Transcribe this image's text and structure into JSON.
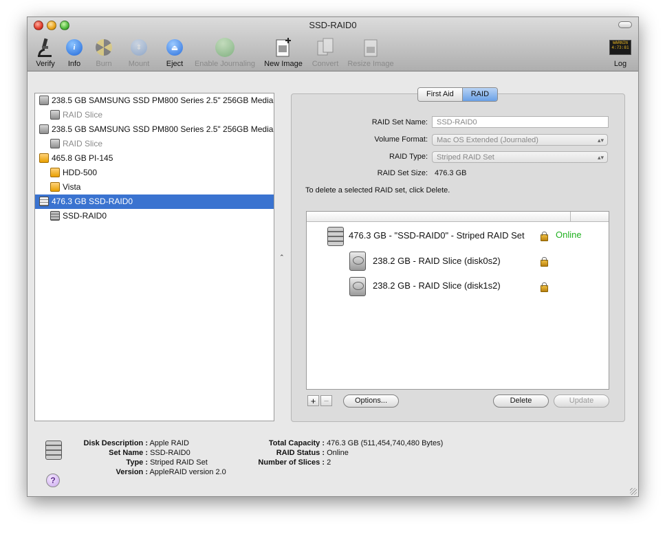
{
  "window": {
    "title": "SSD-RAID0"
  },
  "toolbar": {
    "items": [
      {
        "label": "Verify",
        "icon": "microscope-icon",
        "enabled": true
      },
      {
        "label": "Info",
        "icon": "info-icon",
        "enabled": true
      },
      {
        "label": "Burn",
        "icon": "burn-icon",
        "enabled": false
      },
      {
        "label": "Mount",
        "icon": "mount-icon",
        "enabled": false
      },
      {
        "label": "Eject",
        "icon": "eject-icon",
        "enabled": true
      },
      {
        "label": "Enable Journaling",
        "icon": "journal-icon",
        "enabled": false
      },
      {
        "label": "New Image",
        "icon": "new-image-icon",
        "enabled": true
      },
      {
        "label": "Convert",
        "icon": "convert-icon",
        "enabled": false
      },
      {
        "label": "Resize Image",
        "icon": "resize-image-icon",
        "enabled": false
      }
    ],
    "log": {
      "label": "Log",
      "icon": "log-icon"
    }
  },
  "sidebar": {
    "items": [
      {
        "label": "238.5 GB SAMSUNG SSD PM800 Series 2.5\" 256GB Media",
        "icon": "hdd-icon",
        "indent": 0,
        "dim": false,
        "selected": false
      },
      {
        "label": "RAID Slice",
        "icon": "hdd-icon",
        "indent": 1,
        "dim": true,
        "selected": false
      },
      {
        "label": "238.5 GB SAMSUNG SSD PM800 Series 2.5\" 256GB Media",
        "icon": "hdd-icon",
        "indent": 0,
        "dim": false,
        "selected": false
      },
      {
        "label": "RAID Slice",
        "icon": "hdd-icon",
        "indent": 1,
        "dim": true,
        "selected": false
      },
      {
        "label": "465.8 GB PI-145",
        "icon": "external-disk-icon",
        "indent": 0,
        "dim": false,
        "selected": false
      },
      {
        "label": "HDD-500",
        "icon": "external-disk-icon",
        "indent": 1,
        "dim": false,
        "selected": false
      },
      {
        "label": "Vista",
        "icon": "external-disk-icon",
        "indent": 1,
        "dim": false,
        "selected": false
      },
      {
        "label": "476.3 GB SSD-RAID0",
        "icon": "raid-icon",
        "indent": 0,
        "dim": false,
        "selected": true
      },
      {
        "label": "SSD-RAID0",
        "icon": "raid-icon",
        "indent": 1,
        "dim": false,
        "selected": false
      }
    ]
  },
  "tabs": [
    {
      "label": "First Aid",
      "active": false
    },
    {
      "label": "RAID",
      "active": true
    }
  ],
  "raid": {
    "set_name_label": "RAID Set Name:",
    "set_name_value": "SSD-RAID0",
    "volume_format_label": "Volume Format:",
    "volume_format_value": "Mac OS Extended (Journaled)",
    "raid_type_label": "RAID Type:",
    "raid_type_value": "Striped RAID Set",
    "set_size_label": "RAID Set Size:",
    "set_size_value": "476.3 GB",
    "hint": "To delete a selected RAID set, click Delete.",
    "rows": [
      {
        "label": "476.3 GB - \"SSD-RAID0\" - Striped RAID Set",
        "status": "Online"
      },
      {
        "label": "238.2 GB - RAID Slice (disk0s2)",
        "status": ""
      },
      {
        "label": "238.2 GB - RAID Slice (disk1s2)",
        "status": ""
      }
    ],
    "buttons": {
      "add": "+",
      "remove": "−",
      "options": "Options...",
      "delete": "Delete",
      "update": "Update"
    }
  },
  "info": {
    "disk_description_label": "Disk Description :",
    "disk_description_value": "Apple RAID",
    "set_name_label": "Set Name :",
    "set_name_value": "SSD-RAID0",
    "type_label": "Type :",
    "type_value": "Striped RAID Set",
    "version_label": "Version :",
    "version_value": "AppleRAID version 2.0",
    "total_capacity_label": "Total Capacity :",
    "total_capacity_value": "476.3 GB (511,454,740,480 Bytes)",
    "raid_status_label": "RAID Status :",
    "raid_status_value": "Online",
    "num_slices_label": "Number of Slices :",
    "num_slices_value": "2",
    "help": "?"
  },
  "colors": {
    "selection": "#3a73d0",
    "online": "#1fb11f"
  }
}
